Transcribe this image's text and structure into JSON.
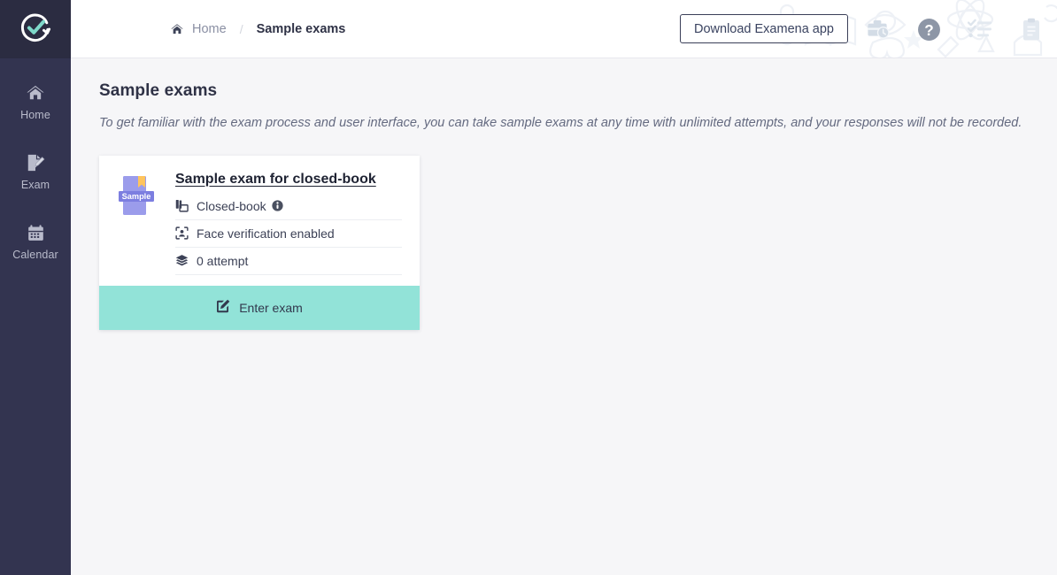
{
  "brand": {
    "logo_icon": "circular-check-logo",
    "accent_color": "#92e3d8",
    "sidebar_color": "#333450"
  },
  "sidebar": {
    "items": [
      {
        "label": "Home",
        "icon": "home-icon"
      },
      {
        "label": "Exam",
        "icon": "exam-document-pencil-icon"
      },
      {
        "label": "Calendar",
        "icon": "calendar-icon"
      }
    ]
  },
  "topbar": {
    "breadcrumb": {
      "home_icon": "home-icon",
      "home_label": "Home",
      "separator": "/",
      "current": "Sample exams"
    },
    "download_button": "Download Examena app",
    "icons": [
      {
        "name": "bell-icon"
      },
      {
        "name": "briefcase-clock-icon"
      },
      {
        "name": "question-mark-circle-icon"
      },
      {
        "name": "checklist-icon"
      },
      {
        "name": "clipboard-icon"
      }
    ]
  },
  "page": {
    "title": "Sample exams",
    "subtitle": "To get familiar with the exam process and user interface, you can take sample exams at any time with unlimited attempts, and your responses will not be recorded."
  },
  "exam_cards": [
    {
      "thumb_label": "Sample",
      "title": "Sample exam for closed-book",
      "meta": [
        {
          "icon": "book-copy-icon",
          "label": "Closed-book",
          "info_icon": "info-circle-icon"
        },
        {
          "icon": "face-scan-icon",
          "label": "Face verification enabled",
          "info_icon": ""
        },
        {
          "icon": "layers-stack-icon",
          "label": "0 attempt",
          "info_icon": ""
        }
      ],
      "action_icon": "pencil-square-icon",
      "action_label": "Enter exam"
    }
  ]
}
